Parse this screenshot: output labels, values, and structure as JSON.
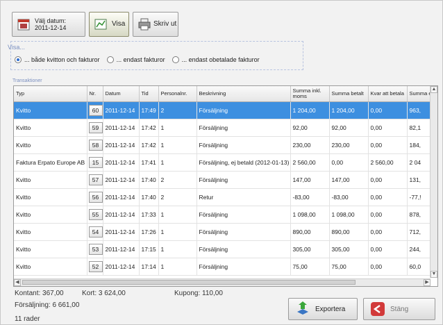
{
  "toolbar": {
    "date_label": "Välj datum:",
    "date_value": "2011-12-14",
    "show_label": "Visa",
    "print_label": "Skriv ut"
  },
  "visa": {
    "title": "Visa...",
    "options": [
      "... både kvitton och fakturor",
      "... endast fakturor",
      "... endast obetalade fakturor"
    ],
    "selected": 0
  },
  "transactions": {
    "title": "Transaktioner",
    "columns": [
      "Typ",
      "Nr.",
      "Datum",
      "Tid",
      "Personalnr.",
      "Beskrivning",
      "Summa inkl. moms",
      "Summa betalt",
      "Kvar att betala",
      "Summa exkl."
    ],
    "rows": [
      {
        "typ": "Kvitto",
        "nr": "60",
        "datum": "2011-12-14",
        "tid": "17:49",
        "pers": "2",
        "besk": "Försäljning",
        "inkl": "1 204,00",
        "betalt": "1 204,00",
        "kvar": "0,00",
        "exkl": "963,"
      },
      {
        "typ": "Kvitto",
        "nr": "59",
        "datum": "2011-12-14",
        "tid": "17:42",
        "pers": "1",
        "besk": "Försäljning",
        "inkl": "92,00",
        "betalt": "92,00",
        "kvar": "0,00",
        "exkl": "82,1"
      },
      {
        "typ": "Kvitto",
        "nr": "58",
        "datum": "2011-12-14",
        "tid": "17:42",
        "pers": "1",
        "besk": "Försäljning",
        "inkl": "230,00",
        "betalt": "230,00",
        "kvar": "0,00",
        "exkl": "184,"
      },
      {
        "typ": "Faktura Erpato Europe AB",
        "nr": "15",
        "datum": "2011-12-14",
        "tid": "17:41",
        "pers": "1",
        "besk": "Försäljning, ej betald (2012-01-13)",
        "inkl": "2 560,00",
        "betalt": "0,00",
        "kvar": "2 560,00",
        "exkl": "2 04"
      },
      {
        "typ": "Kvitto",
        "nr": "57",
        "datum": "2011-12-14",
        "tid": "17:40",
        "pers": "2",
        "besk": "Försäljning",
        "inkl": "147,00",
        "betalt": "147,00",
        "kvar": "0,00",
        "exkl": "131,"
      },
      {
        "typ": "Kvitto",
        "nr": "56",
        "datum": "2011-12-14",
        "tid": "17:40",
        "pers": "2",
        "besk": "Retur",
        "inkl": "-83,00",
        "betalt": "-83,00",
        "kvar": "0,00",
        "exkl": "-77,!"
      },
      {
        "typ": "Kvitto",
        "nr": "55",
        "datum": "2011-12-14",
        "tid": "17:33",
        "pers": "1",
        "besk": "Försäljning",
        "inkl": "1 098,00",
        "betalt": "1 098,00",
        "kvar": "0,00",
        "exkl": "878,"
      },
      {
        "typ": "Kvitto",
        "nr": "54",
        "datum": "2011-12-14",
        "tid": "17:26",
        "pers": "1",
        "besk": "Försäljning",
        "inkl": "890,00",
        "betalt": "890,00",
        "kvar": "0,00",
        "exkl": "712,"
      },
      {
        "typ": "Kvitto",
        "nr": "53",
        "datum": "2011-12-14",
        "tid": "17:15",
        "pers": "1",
        "besk": "Försäljning",
        "inkl": "305,00",
        "betalt": "305,00",
        "kvar": "0,00",
        "exkl": "244,"
      },
      {
        "typ": "Kvitto",
        "nr": "52",
        "datum": "2011-12-14",
        "tid": "17:14",
        "pers": "1",
        "besk": "Försäljning",
        "inkl": "75,00",
        "betalt": "75,00",
        "kvar": "0,00",
        "exkl": "60,0"
      }
    ],
    "selected_index": 0
  },
  "summary": {
    "kontant": "Kontant: 367,00",
    "kort": "Kort: 3 624,00",
    "kupong": "Kupong: 110,00",
    "forsaljning": "Försäljning: 6 661,00",
    "rader": "11 rader"
  },
  "buttons": {
    "export": "Exportera",
    "close": "Stäng"
  }
}
